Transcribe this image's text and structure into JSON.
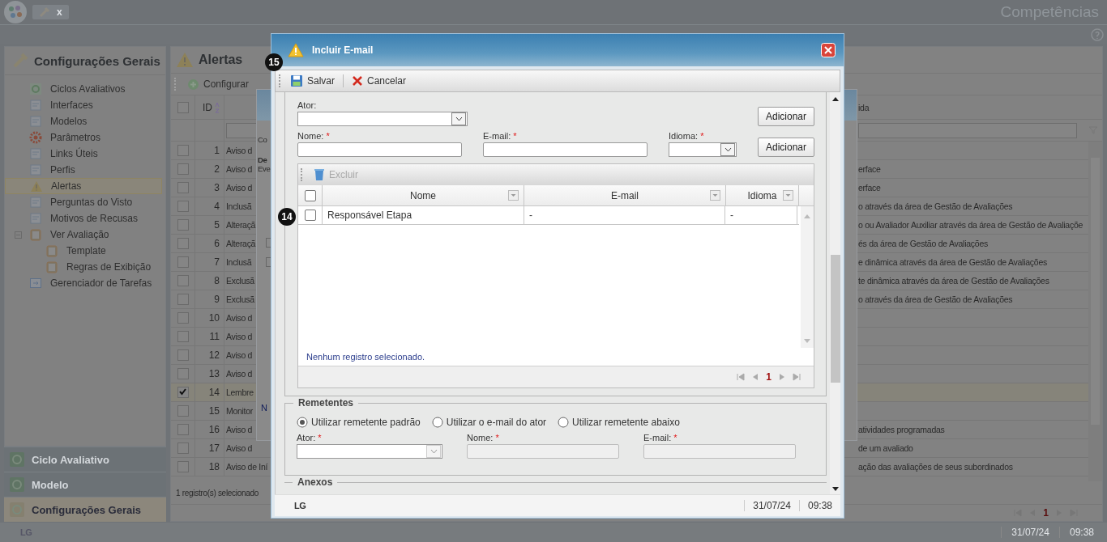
{
  "app": {
    "title": "Competências",
    "tab_close": "x"
  },
  "sidebar": {
    "title": "Configurações Gerais",
    "items": [
      {
        "label": "Ciclos Avaliativos",
        "selected": false
      },
      {
        "label": "Interfaces",
        "selected": false
      },
      {
        "label": "Modelos",
        "selected": false
      },
      {
        "label": "Parâmetros",
        "selected": false
      },
      {
        "label": "Links Úteis",
        "selected": false
      },
      {
        "label": "Perfis",
        "selected": false
      },
      {
        "label": "Alertas",
        "selected": true
      },
      {
        "label": "Perguntas do Visto",
        "selected": false
      },
      {
        "label": "Motivos de Recusas",
        "selected": false
      },
      {
        "label": "Ver Avaliação",
        "selected": false,
        "expanded": true,
        "children": [
          {
            "label": "Template",
            "selected": false
          },
          {
            "label": "Regras de Exibição",
            "selected": false
          }
        ]
      },
      {
        "label": "Gerenciador de Tarefas",
        "selected": false
      }
    ]
  },
  "accordion": [
    {
      "label": "Ciclo Avaliativo",
      "selected": false
    },
    {
      "label": "Modelo",
      "selected": false
    },
    {
      "label": "Configurações Gerais",
      "selected": true
    }
  ],
  "main": {
    "title": "Alertas",
    "toolbar": [
      "Configurar"
    ],
    "header_checked": false,
    "id_header": "ID",
    "right_header": "ida",
    "rows": [
      {
        "id": "1",
        "checked": false,
        "left": "Aviso d"
      },
      {
        "id": "2",
        "checked": false,
        "left": "Aviso d",
        "right": "erface"
      },
      {
        "id": "3",
        "checked": false,
        "left": "Aviso d",
        "right": "erface"
      },
      {
        "id": "4",
        "checked": false,
        "left": "Inclusã",
        "right": "o através da área de Gestão de Avaliações"
      },
      {
        "id": "5",
        "checked": false,
        "left": "Alteraçã",
        "right": "o ou Avaliador Auxiliar através da área de Gestão de Avaliaçõe"
      },
      {
        "id": "6",
        "checked": false,
        "left": "Alteraçã",
        "right": "és da área de Gestão de Avaliações"
      },
      {
        "id": "7",
        "checked": false,
        "left": "Inclusã",
        "right": "e dinâmica através da área de Gestão de Avaliações"
      },
      {
        "id": "8",
        "checked": false,
        "left": "Exclusã",
        "right": "te dinâmica através da área de Gestão de Avaliações"
      },
      {
        "id": "9",
        "checked": false,
        "left": "Exclusã",
        "right": "o através da área de Gestão de Avaliações"
      },
      {
        "id": "10",
        "checked": false,
        "left": "Aviso d"
      },
      {
        "id": "11",
        "checked": false,
        "left": "Aviso d"
      },
      {
        "id": "12",
        "checked": false,
        "left": "Aviso d"
      },
      {
        "id": "13",
        "checked": false,
        "left": "Aviso d"
      },
      {
        "id": "14",
        "checked": true,
        "left": "Lembre"
      },
      {
        "id": "15",
        "checked": false,
        "left": "Monitor"
      },
      {
        "id": "16",
        "checked": false,
        "left": "Aviso d",
        "right": "atividades programadas"
      },
      {
        "id": "17",
        "checked": false,
        "left": "Aviso d",
        "right": "de um avaliado"
      },
      {
        "id": "18",
        "checked": false,
        "left": "Aviso de Iní",
        "right": "ação das avaliações de seus subordinados"
      }
    ],
    "status": "1 registro(s) selecionado",
    "page": "1"
  },
  "back_dialog": {
    "fragments": [
      "Co",
      "De",
      "Eve"
    ],
    "footer_fragment": "N"
  },
  "footer": {
    "logo": "LG",
    "date": "31/07/24",
    "time": "09:38"
  },
  "modal": {
    "title": "Incluir E-mail",
    "toolbar": [
      {
        "kind": "save",
        "label": "Salvar"
      },
      {
        "kind": "cancel",
        "label": "Cancelar"
      }
    ],
    "actor_label": "Ator:",
    "add_buttons": [
      "Adicionar",
      "Adicionar"
    ],
    "fields": [
      {
        "label": "Nome:",
        "mark": "*",
        "kind": "text"
      },
      {
        "label": "E-mail:",
        "mark": "*",
        "kind": "text"
      },
      {
        "label": "Idioma:",
        "mark": "*",
        "kind": "select"
      }
    ],
    "grid": {
      "delete_label": "Excluir",
      "delete_disabled": true,
      "header_checked": false,
      "columns": [
        "Nome",
        "E-mail",
        "Idioma"
      ],
      "rows": [
        {
          "checked": false,
          "cells": [
            "Responsável Etapa",
            "-",
            "-"
          ]
        }
      ],
      "message": "Nenhum registro selecionado.",
      "page": "1"
    },
    "senders": {
      "legend": "Remetentes",
      "options": [
        {
          "label": "Utilizar remetente padrão",
          "selected": true
        },
        {
          "label": "Utilizar o e-mail do ator",
          "selected": false
        },
        {
          "label": "Utilizar remetente abaixo",
          "selected": false
        }
      ],
      "fields": [
        {
          "label": "Ator:",
          "mark": "*",
          "kind": "select",
          "disabled": false
        },
        {
          "label": "Nome:",
          "mark": "*",
          "kind": "text",
          "disabled": true
        },
        {
          "label": "E-mail:",
          "mark": "*",
          "kind": "text",
          "disabled": true
        }
      ]
    },
    "attachments_legend": "Anexos",
    "footer": {
      "logo": "LG",
      "date": "31/07/24",
      "time": "09:38"
    }
  },
  "markers": [
    "15",
    "14"
  ]
}
